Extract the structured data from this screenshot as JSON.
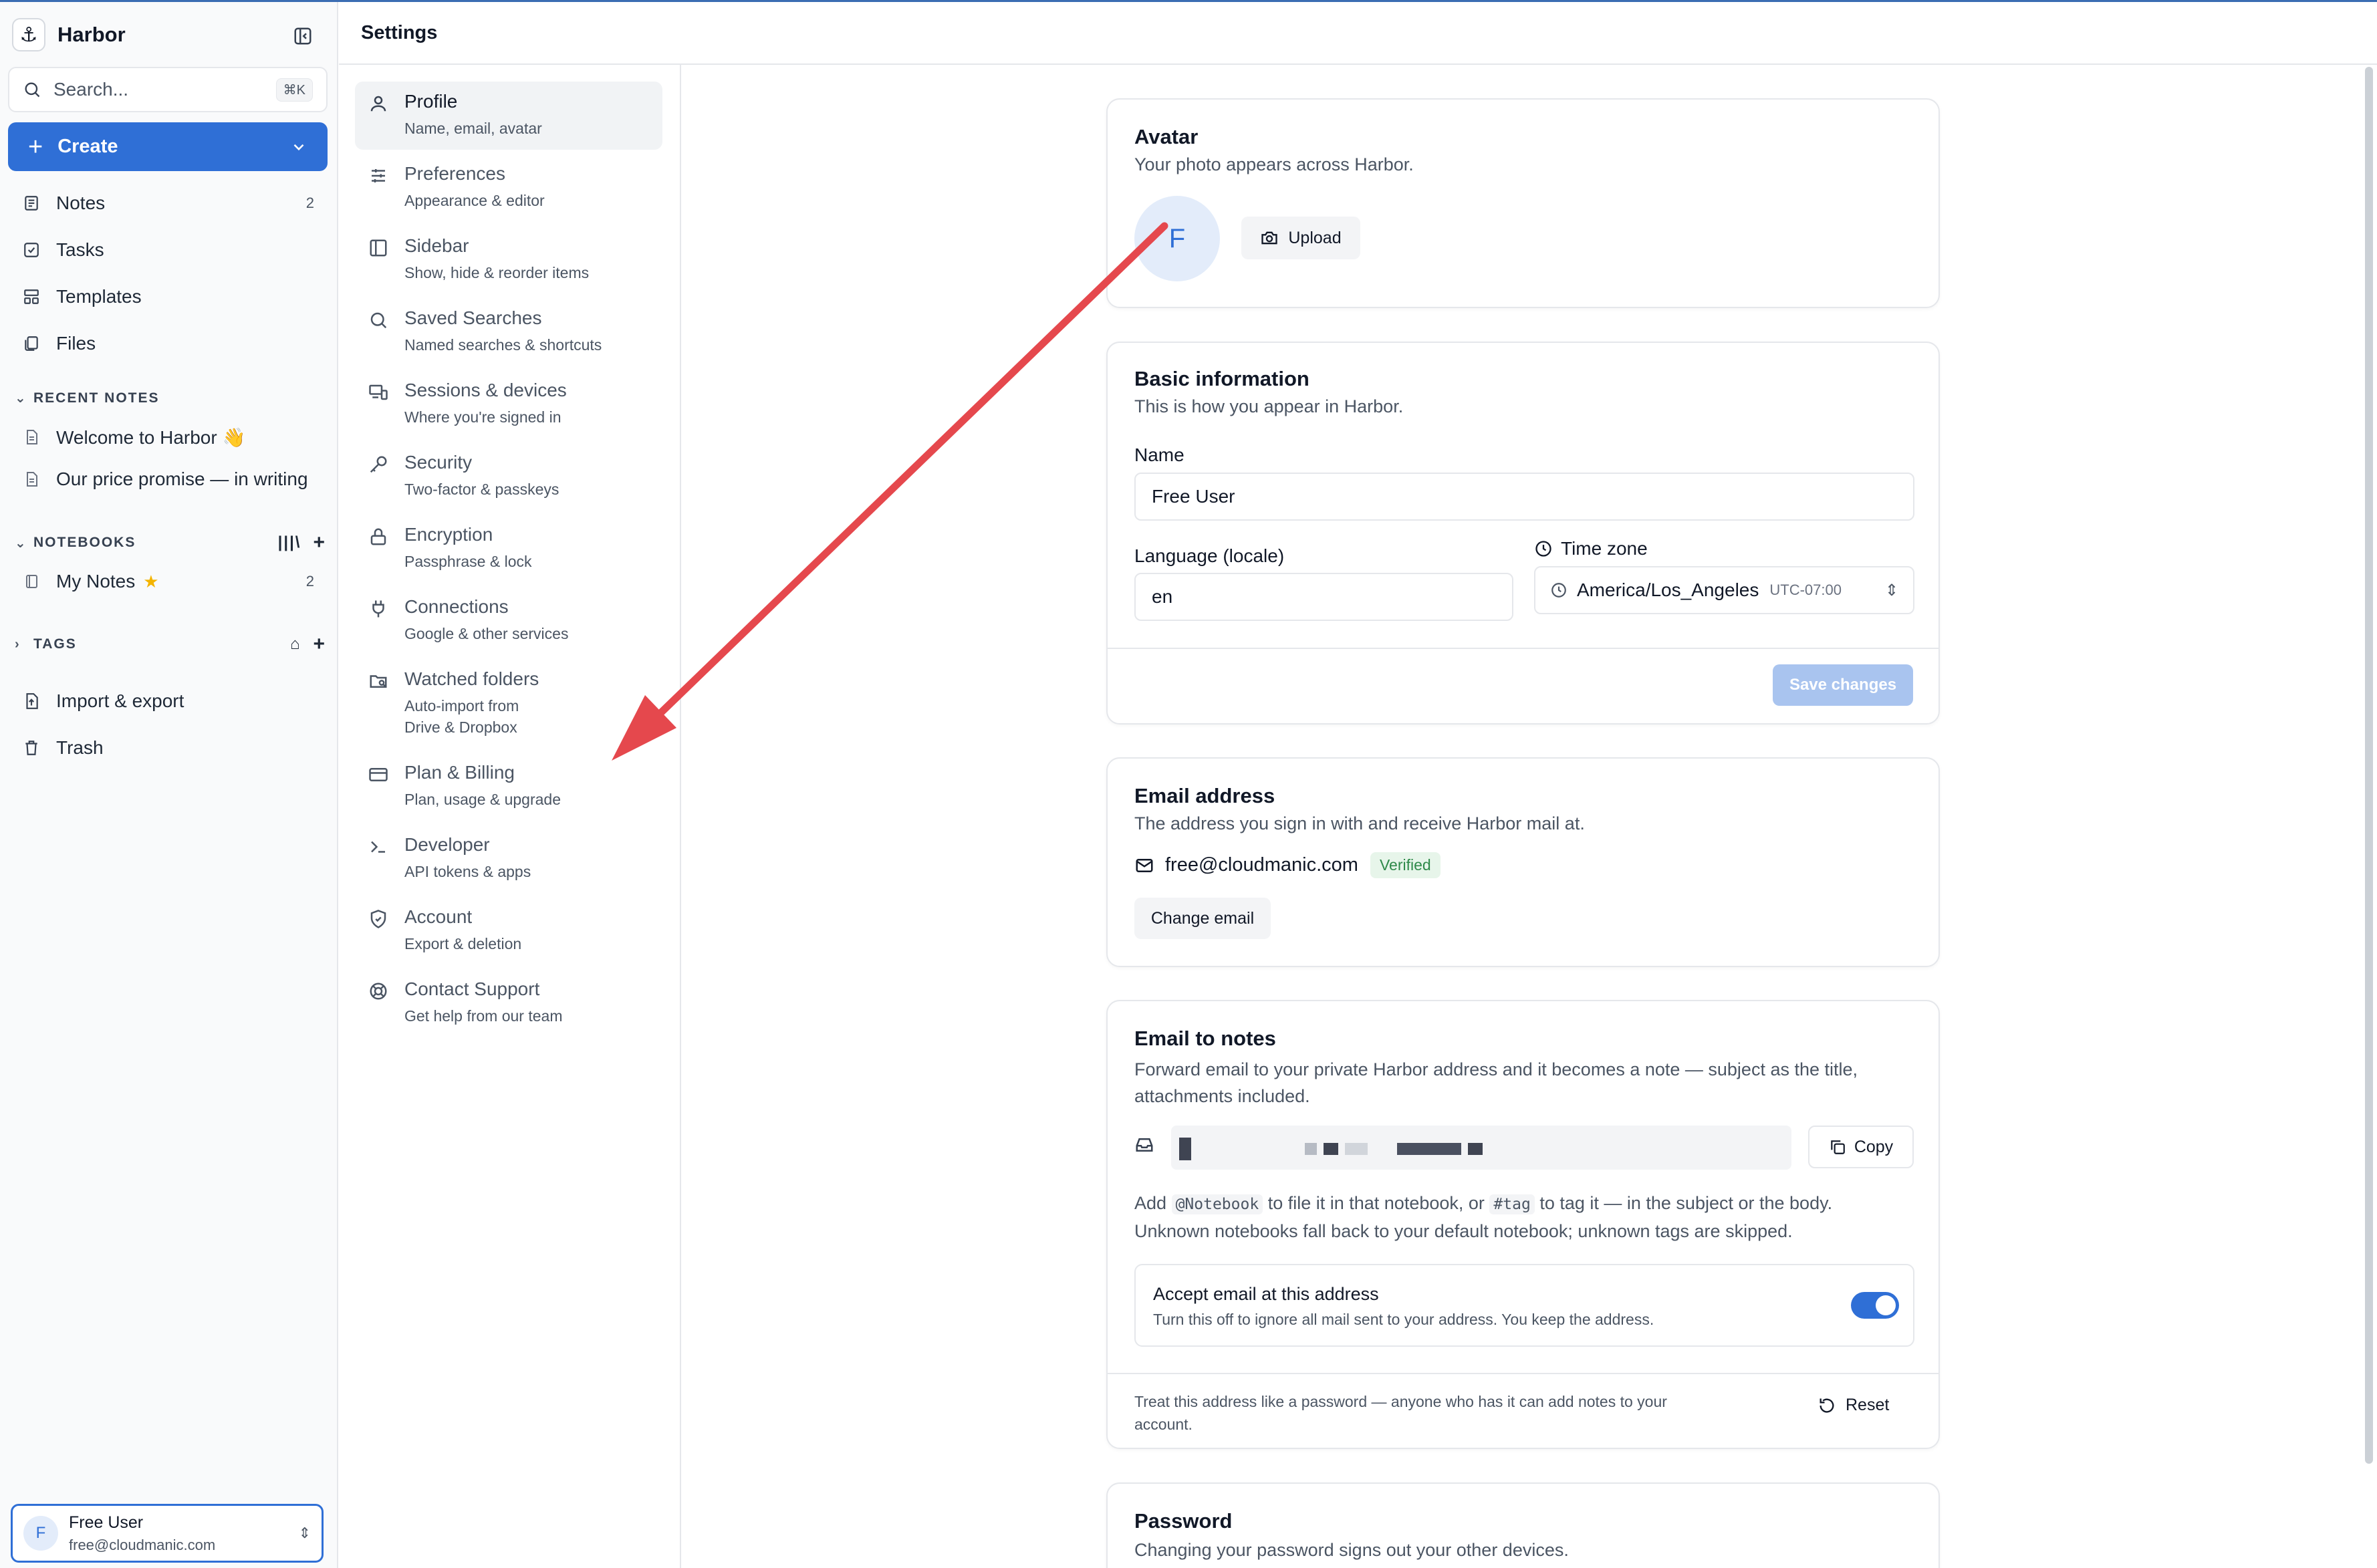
{
  "app": {
    "name": "Harbor",
    "search_placeholder": "Search...",
    "search_shortcut": "⌘K",
    "create_label": "Create"
  },
  "sidebar": {
    "nav": [
      {
        "label": "Notes",
        "count": "2",
        "icon": "notes-icon"
      },
      {
        "label": "Tasks",
        "count": "",
        "icon": "tasks-icon"
      },
      {
        "label": "Templates",
        "count": "",
        "icon": "templates-icon"
      },
      {
        "label": "Files",
        "count": "",
        "icon": "files-icon"
      }
    ],
    "recent_notes_title": "RECENT NOTES",
    "recent_notes": [
      {
        "label": "Welcome to Harbor 👋"
      },
      {
        "label": "Our price promise — in writing"
      }
    ],
    "notebooks_title": "NOTEBOOKS",
    "notebooks": [
      {
        "label": "My Notes",
        "count": "2",
        "starred": true
      }
    ],
    "tags_title": "TAGS",
    "bottom": [
      {
        "label": "Import & export",
        "icon": "import-icon"
      },
      {
        "label": "Trash",
        "icon": "trash-icon"
      }
    ],
    "user": {
      "initial": "F",
      "name": "Free User",
      "email": "free@cloudmanic.com"
    }
  },
  "settings": {
    "title": "Settings",
    "nav": [
      {
        "label": "Profile",
        "sub": "Name, email, avatar",
        "icon": "person-icon",
        "active": true
      },
      {
        "label": "Preferences",
        "sub": "Appearance & editor",
        "icon": "sliders-icon"
      },
      {
        "label": "Sidebar",
        "sub": "Show, hide & reorder items",
        "icon": "sidebar-icon"
      },
      {
        "label": "Saved Searches",
        "sub": "Named searches & shortcuts",
        "icon": "search-icon"
      },
      {
        "label": "Sessions & devices",
        "sub": "Where you're signed in",
        "icon": "devices-icon"
      },
      {
        "label": "Security",
        "sub": "Two-factor & passkeys",
        "icon": "key-icon"
      },
      {
        "label": "Encryption",
        "sub": "Passphrase & lock",
        "icon": "lock-icon"
      },
      {
        "label": "Connections",
        "sub": "Google & other services",
        "icon": "plug-icon"
      },
      {
        "label": "Watched folders",
        "sub": "Auto-import from Drive & Dropbox",
        "sub2": "Drive & Dropbox",
        "sub1": "Auto-import from",
        "icon": "folder-search-icon"
      },
      {
        "label": "Plan & Billing",
        "sub": "Plan, usage & upgrade",
        "icon": "card-icon"
      },
      {
        "label": "Developer",
        "sub": "API tokens & apps",
        "icon": "terminal-icon"
      },
      {
        "label": "Account",
        "sub": "Export & deletion",
        "icon": "shield-icon"
      },
      {
        "label": "Contact Support",
        "sub": "Get help from our team",
        "icon": "lifebuoy-icon"
      }
    ]
  },
  "avatar_card": {
    "title": "Avatar",
    "desc": "Your photo appears across Harbor.",
    "initial": "F",
    "upload_label": "Upload"
  },
  "basic_card": {
    "title": "Basic information",
    "desc": "This is how you appear in Harbor.",
    "name_label": "Name",
    "name_value": "Free User",
    "language_label": "Language (locale)",
    "language_value": "en",
    "timezone_label": "Time zone",
    "timezone_value": "America/Los_Angeles",
    "timezone_offset": "UTC-07:00",
    "save_label": "Save changes"
  },
  "email_card": {
    "title": "Email address",
    "desc": "The address you sign in with and receive Harbor mail at.",
    "email": "free@cloudmanic.com",
    "badge": "Verified",
    "change_label": "Change email"
  },
  "email_notes_card": {
    "title": "Email to notes",
    "desc_line1": "Forward email to your private Harbor address and it becomes a note — subject as the title,",
    "desc_line2": "attachments included.",
    "copy_label": "Copy",
    "help_pre": "Add",
    "help_code1": "@Notebook",
    "help_mid": "to file it in that notebook, or",
    "help_code2": "#tag",
    "help_post": "to tag it — in the subject or the body.",
    "help_line2": "Unknown notebooks fall back to your default notebook; unknown tags are skipped.",
    "accept_title": "Accept email at this address",
    "accept_desc": "Turn this off to ignore all mail sent to your address. You keep the address.",
    "accept_enabled": true,
    "footer_line1": "Treat this address like a password — anyone who has it can add notes to your",
    "footer_line2": "account.",
    "reset_label": "Reset"
  },
  "password_card": {
    "title": "Password",
    "desc": "Changing your password signs out your other devices."
  },
  "colors": {
    "accent": "#2f6fd6",
    "annotation_arrow": "#e5484d",
    "verified_bg": "#e7f5ea",
    "verified_text": "#2f8a4a"
  }
}
